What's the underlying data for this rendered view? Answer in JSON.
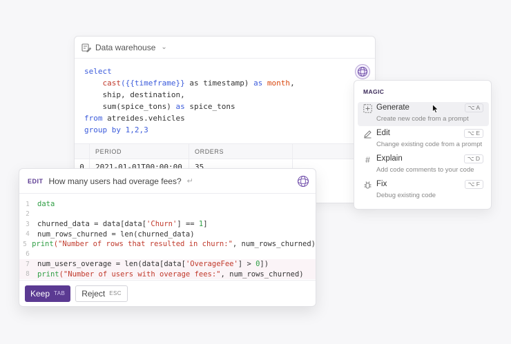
{
  "sql_card": {
    "source_label": "Data warehouse",
    "code": {
      "l1": "select",
      "l2_fn": "cast",
      "l2_tpl": "({{timeframe}}",
      "l2_mid": " as timestamp) ",
      "l2_as": "as",
      "l2_alias": " month",
      "l2_end": ",",
      "l3": "ship, destination,",
      "l4_a": "sum(spice_tons) ",
      "l4_as": "as",
      "l4_b": " spice_tons",
      "l5_kw": "from",
      "l5_b": " atreides.vehicles",
      "l6_kw": "group by",
      "l6_nums": " 1,2,3"
    },
    "table": {
      "columns": [
        "PERIOD",
        "ORDERS"
      ],
      "row": {
        "index": "0",
        "period": "2021-01-01T00:00:00",
        "orders": "35"
      }
    }
  },
  "magic_menu": {
    "title": "MAGIC",
    "items": [
      {
        "label": "Generate",
        "desc": "Create new code from a prompt",
        "key": "⌥ A",
        "icon": "plus-box-icon"
      },
      {
        "label": "Edit",
        "desc": "Change existing code from a prompt",
        "key": "⌥ E",
        "icon": "pencil-icon"
      },
      {
        "label": "Explain",
        "desc": "Add code comments to your code",
        "key": "⌥ D",
        "icon": "hash-icon"
      },
      {
        "label": "Fix",
        "desc": "Debug existing code",
        "key": "⌥ F",
        "icon": "bug-icon"
      }
    ]
  },
  "edit_card": {
    "tag": "EDIT",
    "prompt": "How many users had overage fees?",
    "lines": {
      "n1": "1",
      "t1": "data",
      "n2": "2",
      "n3": "3",
      "t3a": "churned_data = data[data[",
      "t3s": "'Churn'",
      "t3b": "] == ",
      "t3n": "1",
      "t3c": "]",
      "n4": "4",
      "t4": "num_rows_churned = len(churned_data)",
      "n5": "5",
      "t5a": "print",
      "t5s": "(\"Number of rows that resulted in churn:\"",
      "t5b": ", num_rows_churned)",
      "n6": "6",
      "n7": "7",
      "t7a": "num_users_overage = len(data[data[",
      "t7s": "'OverageFee'",
      "t7b": "] > ",
      "t7n": "0",
      "t7c": "])",
      "n8": "8",
      "t8a": "print",
      "t8s": "(\"Number of users with overage fees:\"",
      "t8b": ", num_rows_churned)"
    },
    "keep": {
      "label": "Keep",
      "key": "TAB"
    },
    "reject": {
      "label": "Reject",
      "key": "ESC"
    }
  },
  "colors": {
    "accent": "#5b3a92",
    "keyword": "#3b5bdb",
    "string": "#c0392b"
  }
}
